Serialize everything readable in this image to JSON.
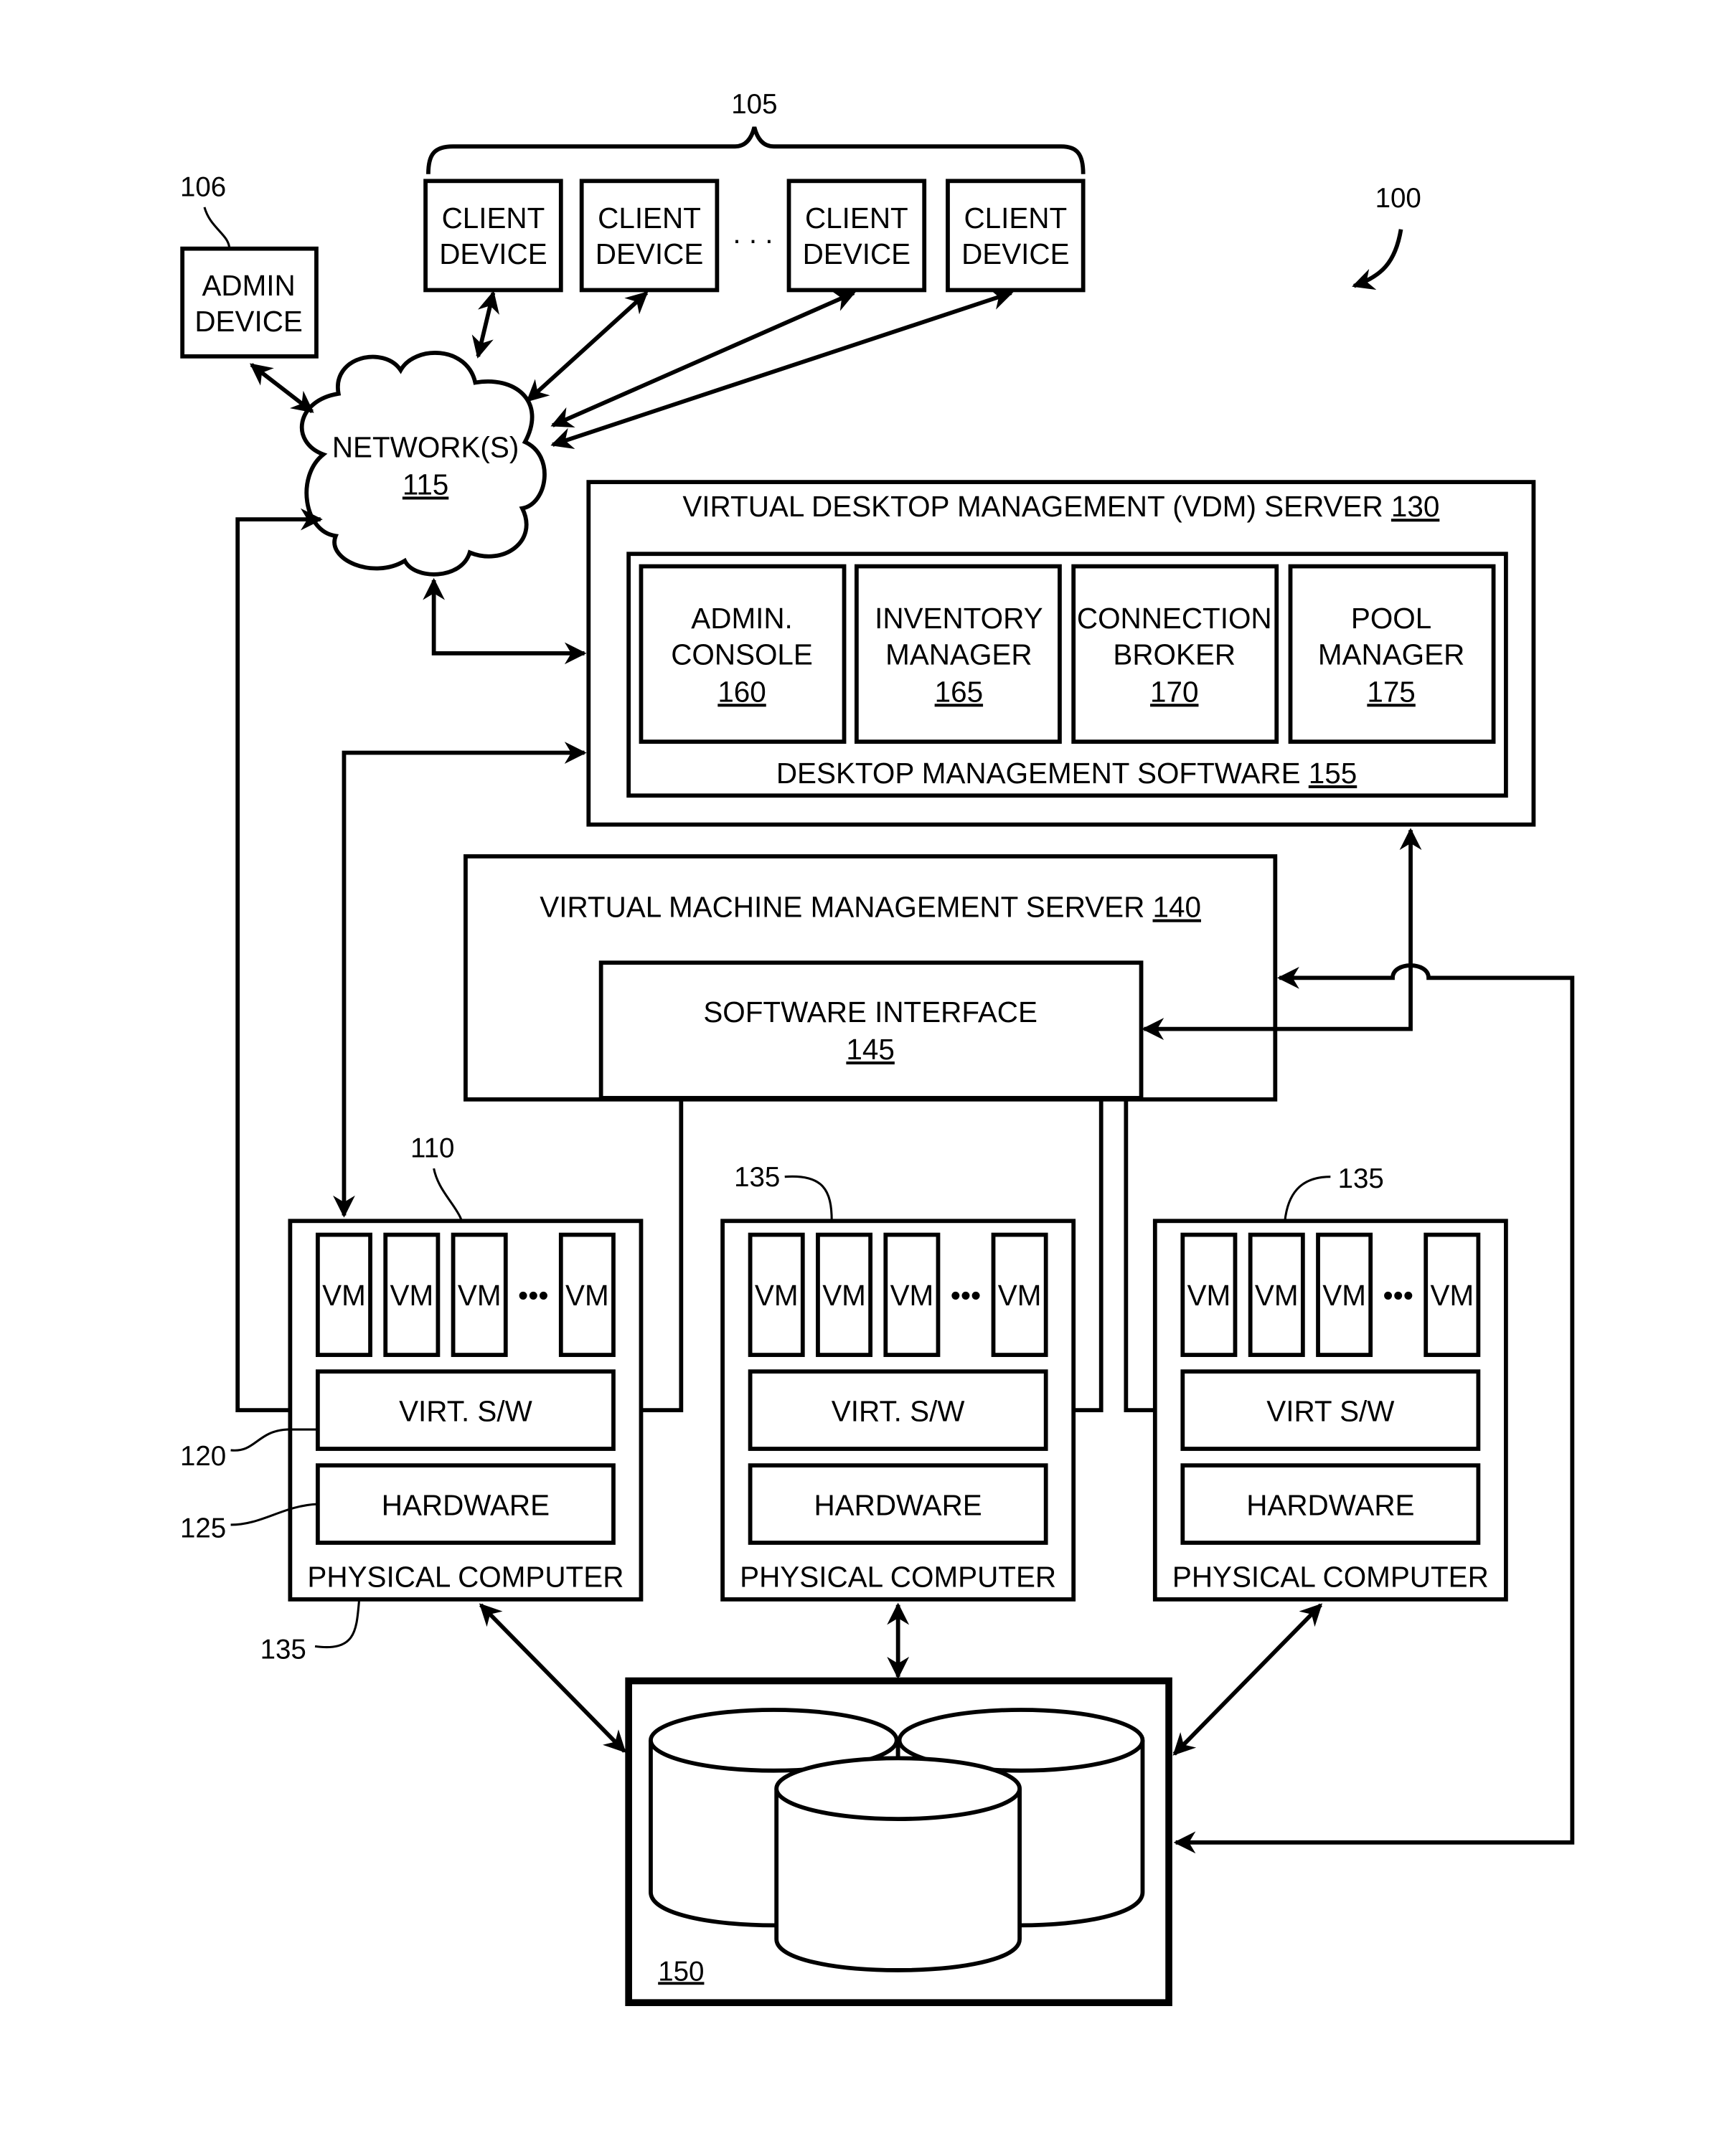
{
  "figure": {
    "ref": "100",
    "client_group_ref": "105",
    "admin_device": {
      "line1": "ADMIN",
      "line2": "DEVICE",
      "ref": "106"
    },
    "client_devices": [
      {
        "line1": "CLIENT",
        "line2": "DEVICE"
      },
      {
        "line1": "CLIENT",
        "line2": "DEVICE"
      },
      {
        "line1": "CLIENT",
        "line2": "DEVICE"
      },
      {
        "line1": "CLIENT",
        "line2": "DEVICE"
      }
    ],
    "ellipsis": ". . .",
    "network": {
      "label": "NETWORK(S)",
      "ref": "115"
    },
    "vdm_server": {
      "label": "VIRTUAL DESKTOP MANAGEMENT (VDM) SERVER",
      "ref": "130",
      "software": {
        "label": "DESKTOP MANAGEMENT SOFTWARE",
        "ref": "155"
      },
      "modules": [
        {
          "line1": "ADMIN.",
          "line2": "CONSOLE",
          "ref": "160"
        },
        {
          "line1": "INVENTORY",
          "line2": "MANAGER",
          "ref": "165"
        },
        {
          "line1": "CONNECTION",
          "line2": "BROKER",
          "ref": "170"
        },
        {
          "line1": "POOL",
          "line2": "MANAGER",
          "ref": "175"
        }
      ]
    },
    "vmm_server": {
      "label": "VIRTUAL MACHINE MANAGEMENT SERVER",
      "ref": "140",
      "interface": {
        "label": "SOFTWARE INTERFACE",
        "ref": "145"
      }
    },
    "physical_computers": [
      {
        "label": "PHYSICAL COMPUTER",
        "ref": "135",
        "vm_label": "VM",
        "vm_ref": "110",
        "virt_label": "VIRT. S/W",
        "virt_ref": "120",
        "hw_label": "HARDWARE",
        "hw_ref": "125"
      },
      {
        "label": "PHYSICAL COMPUTER",
        "ref": "135",
        "vm_label": "VM",
        "virt_label": "VIRT. S/W",
        "hw_label": "HARDWARE"
      },
      {
        "label": "PHYSICAL COMPUTER",
        "ref": "135",
        "vm_label": "VM",
        "virt_label": "VIRT S/W",
        "hw_label": "HARDWARE"
      }
    ],
    "vm_ellipsis": "•••",
    "storage": {
      "ref": "150"
    }
  }
}
